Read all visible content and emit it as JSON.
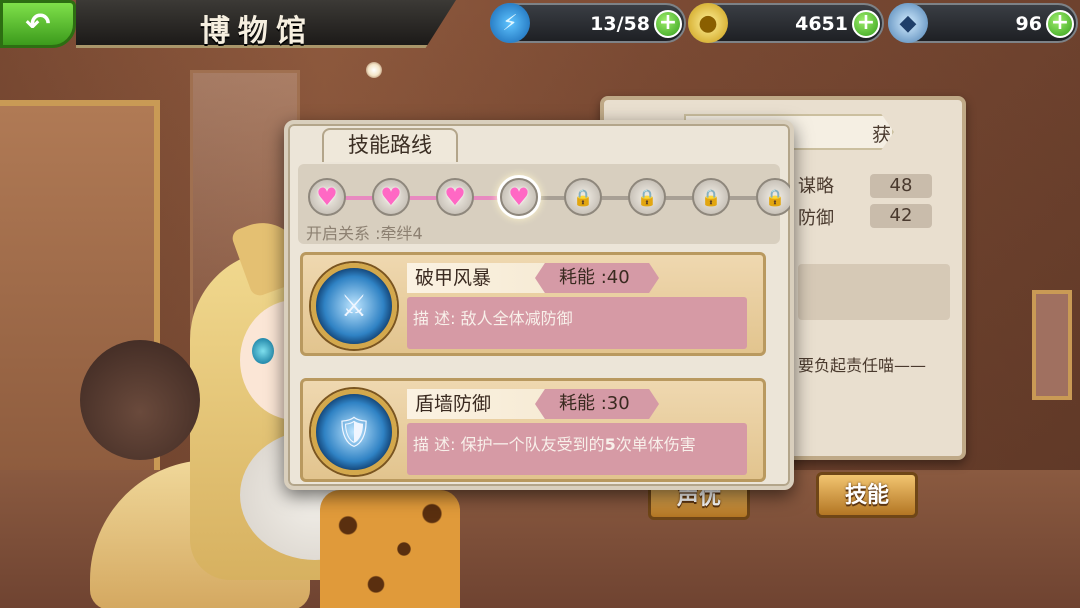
{
  "header": {
    "title": "博物馆",
    "back_icon": "back-arrow-icon"
  },
  "resources": {
    "energy": {
      "value": "13/58",
      "icon": "lightning-icon",
      "plus": "+"
    },
    "gold": {
      "value": "4651",
      "icon": "coin-icon",
      "plus": "+"
    },
    "gem": {
      "value": "96",
      "icon": "crystal-icon",
      "plus": "+"
    }
  },
  "info_panel": {
    "name_partial": "获",
    "stats": [
      {
        "label": "谋略",
        "value": "48"
      },
      {
        "label": "防御",
        "value": "42"
      }
    ],
    "quote": "要负起责任喵——"
  },
  "buttons": {
    "voice": "声优",
    "skill": "技能"
  },
  "skill_route": {
    "tab_label": "技能路线",
    "unlock_caption": "开启关系 :牵绊4",
    "nodes": [
      {
        "state": "unlocked"
      },
      {
        "state": "unlocked"
      },
      {
        "state": "unlocked"
      },
      {
        "state": "current"
      },
      {
        "state": "locked"
      },
      {
        "state": "locked"
      },
      {
        "state": "locked"
      },
      {
        "state": "locked"
      }
    ],
    "progress_fraction": 0.43
  },
  "skills": [
    {
      "name": "破甲风暴",
      "cost": "耗能 :40",
      "desc_prefix": "描 述: ",
      "desc": "敌人全体减防御",
      "icon": "helmet-sword-icon"
    },
    {
      "name": "盾墙防御",
      "cost": "耗能 :30",
      "desc_prefix": "描 述: ",
      "desc_pre": "保护一个队友受到的",
      "desc_strong": "5",
      "desc_post": "次单体伤害",
      "icon": "shield-icon"
    }
  ],
  "colors": {
    "accent_pink": "#d69aa5",
    "heart": "#ff68c4",
    "plus_green": "#35a01c",
    "gold_button": "#e0a24a"
  }
}
